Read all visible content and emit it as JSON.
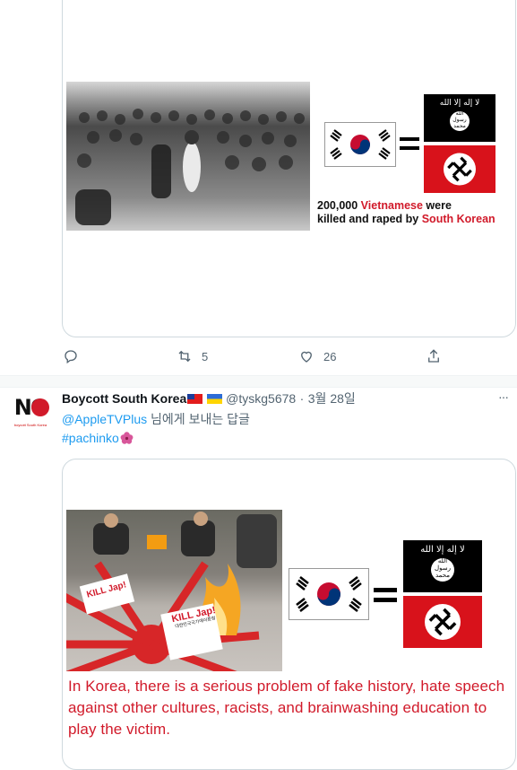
{
  "tweet1": {
    "image": {
      "caption_number": "200,000",
      "caption_red1": "Vietnamese",
      "caption_tail1": "were",
      "caption_line2": "killed and raped by",
      "caption_red2": "South Korean",
      "isis_text": "لا إله إلا الله",
      "isis_seal": "الله رسول محمد"
    },
    "actions": {
      "reply_count": "",
      "retweet_count": "5",
      "like_count": "26"
    }
  },
  "tweet2": {
    "author_name": "Boycott South Korea",
    "author_handle": "@tyskg5678",
    "separator": "·",
    "date": "3월 28일",
    "more": "···",
    "reply_to_handle": "@AppleTVPlus",
    "reply_to_text": " 님에게 보내는 답글",
    "hashtag": "#pachinko",
    "avatar_text": "NO",
    "avatar_sub": "boycott South Korea",
    "image": {
      "sign1": "KILL Jap!",
      "sign2": "대한민국국가에이혼령",
      "caption": "In Korea, there is a serious problem of fake history, hate speech against other cultures, racists, and brainwashing education to play the victim.",
      "isis_text": "لا إله إلا الله",
      "isis_seal": "الله رسول محمد"
    }
  },
  "colors": {
    "accent": "#1d9bf0",
    "caption_red": "#d11a2a",
    "muted": "#536471"
  }
}
